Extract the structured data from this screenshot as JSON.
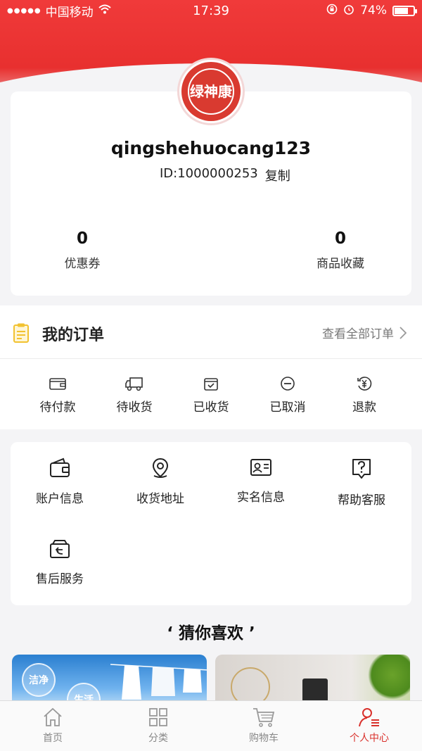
{
  "status_bar": {
    "carrier": "中国移动",
    "time": "17:39",
    "battery": "74%",
    "battery_level": 0.74
  },
  "profile": {
    "logo_text": "绿神康",
    "username": "qingshehuocang123",
    "id_text": "ID:1000000253",
    "copy_label": "复制"
  },
  "stats": [
    {
      "value": "0",
      "label": "优惠券"
    },
    {
      "value": "0",
      "label": "商品收藏"
    }
  ],
  "orders": {
    "title": "我的订单",
    "view_all": "查看全部订单",
    "items": [
      {
        "label": "待付款",
        "icon": "wallet-icon"
      },
      {
        "label": "待收货",
        "icon": "truck-icon"
      },
      {
        "label": "已收货",
        "icon": "received-bag-icon"
      },
      {
        "label": "已取消",
        "icon": "cancel-circle-icon"
      },
      {
        "label": "退款",
        "icon": "refund-yen-icon"
      }
    ]
  },
  "services": [
    {
      "label": "账户信息",
      "icon": "wallet-icon"
    },
    {
      "label": "收货地址",
      "icon": "location-pin-icon"
    },
    {
      "label": "实名信息",
      "icon": "id-card-icon"
    },
    {
      "label": "帮助客服",
      "icon": "help-chat-icon"
    },
    {
      "label": "售后服务",
      "icon": "return-box-icon"
    }
  ],
  "guess": {
    "title": "‘ 猜你喜欢 ’"
  },
  "products": [
    {
      "badge1": "洁净",
      "badge2": "生活"
    },
    {
      "badge1": ""
    }
  ],
  "tabbar": [
    {
      "label": "首页",
      "icon": "home-icon"
    },
    {
      "label": "分类",
      "icon": "grid-icon"
    },
    {
      "label": "购物车",
      "icon": "cart-icon"
    },
    {
      "label": "个人中心",
      "icon": "user-icon",
      "active": true
    }
  ],
  "colors": {
    "brand_red": "#e8302f",
    "active_tab": "#d9302b"
  }
}
